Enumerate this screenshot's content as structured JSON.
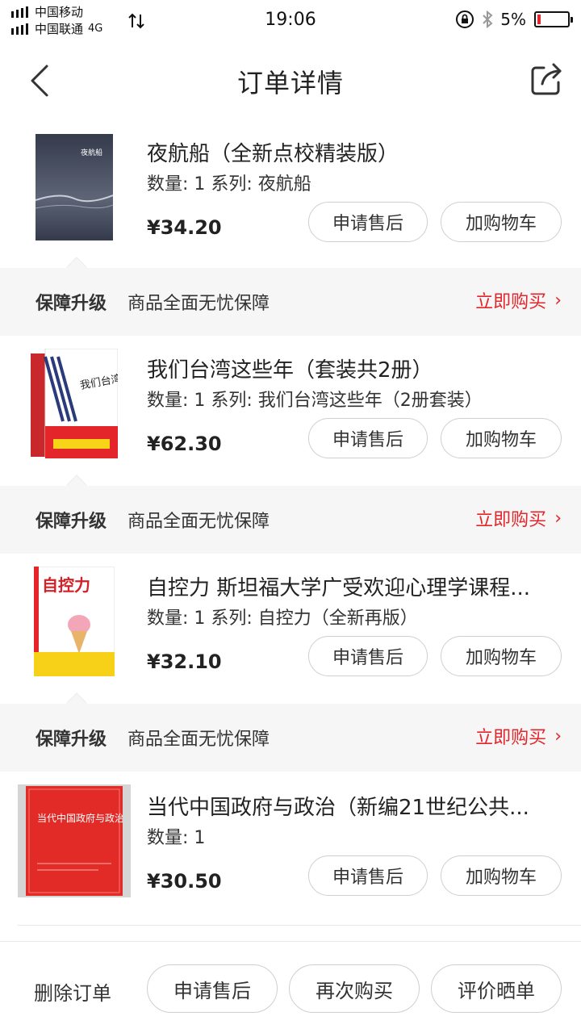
{
  "status_bar": {
    "carrier1": "中国移动",
    "carrier2": "中国联通",
    "network": "4G",
    "time": "19:06",
    "battery": "5%",
    "battery_level": 0.05
  },
  "header": {
    "title": "订单详情",
    "back_icon": "back-arrow-icon",
    "share_icon": "share-icon"
  },
  "products": [
    {
      "name": "夜航船（全新点校精装版）",
      "meta": "数量: 1 系列: 夜航船",
      "price": "¥34.20",
      "after_sale": "申请售后",
      "add_cart": "加购物车",
      "cover_text": "夜航船",
      "guarantee": {
        "title": "保障升级",
        "desc": "商品全面无忧保障",
        "action": "立即购买"
      }
    },
    {
      "name": "我们台湾这些年（套装共2册）",
      "meta": "数量: 1 系列: 我们台湾这些年（2册套装）",
      "price": "¥62.30",
      "after_sale": "申请售后",
      "add_cart": "加购物车",
      "cover_text": "我们台湾这些年",
      "guarantee": {
        "title": "保障升级",
        "desc": "商品全面无忧保障",
        "action": "立即购买"
      }
    },
    {
      "name": "自控力 斯坦福大学广受欢迎心理学课程...",
      "meta": "数量: 1 系列: 自控力（全新再版）",
      "price": "¥32.10",
      "after_sale": "申请售后",
      "add_cart": "加购物车",
      "cover_text": "自控力",
      "guarantee": {
        "title": "保障升级",
        "desc": "商品全面无忧保障",
        "action": "立即购买"
      }
    },
    {
      "name": "当代中国政府与政治（新编21世纪公共...",
      "meta": "数量: 1",
      "price": "¥30.50",
      "after_sale": "申请售后",
      "add_cart": "加购物车",
      "cover_text": "当代中国政府与政治"
    }
  ],
  "bottom_bar": {
    "delete": "删除订单",
    "after_sale": "申请售后",
    "rebuy": "再次购买",
    "review": "评价晒单"
  },
  "colors": {
    "accent": "#e4262b",
    "strip_bg": "#f6f6f6"
  }
}
